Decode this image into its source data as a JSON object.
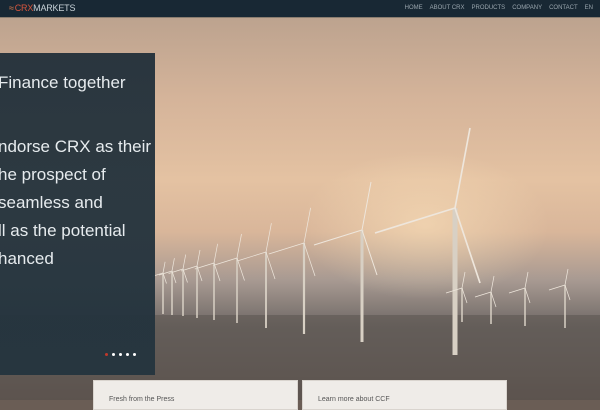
{
  "nav": {
    "logo_mark": "≈",
    "logo_crx": "CRX",
    "logo_rest": "MARKETS",
    "items": [
      "HOME",
      "ABOUT CRX",
      "PRODUCTS",
      "COMPANY",
      "CONTACT",
      "EN"
    ]
  },
  "slide": {
    "lines": [
      "Finance together",
      "ndorse CRX as their",
      "he prospect of",
      "seamless and",
      "ll as the potential",
      "hanced"
    ],
    "dots": 5,
    "active_dot": 0
  },
  "cards": [
    {
      "title": "Fresh from the Press"
    },
    {
      "title": "Learn more about CCF"
    }
  ]
}
